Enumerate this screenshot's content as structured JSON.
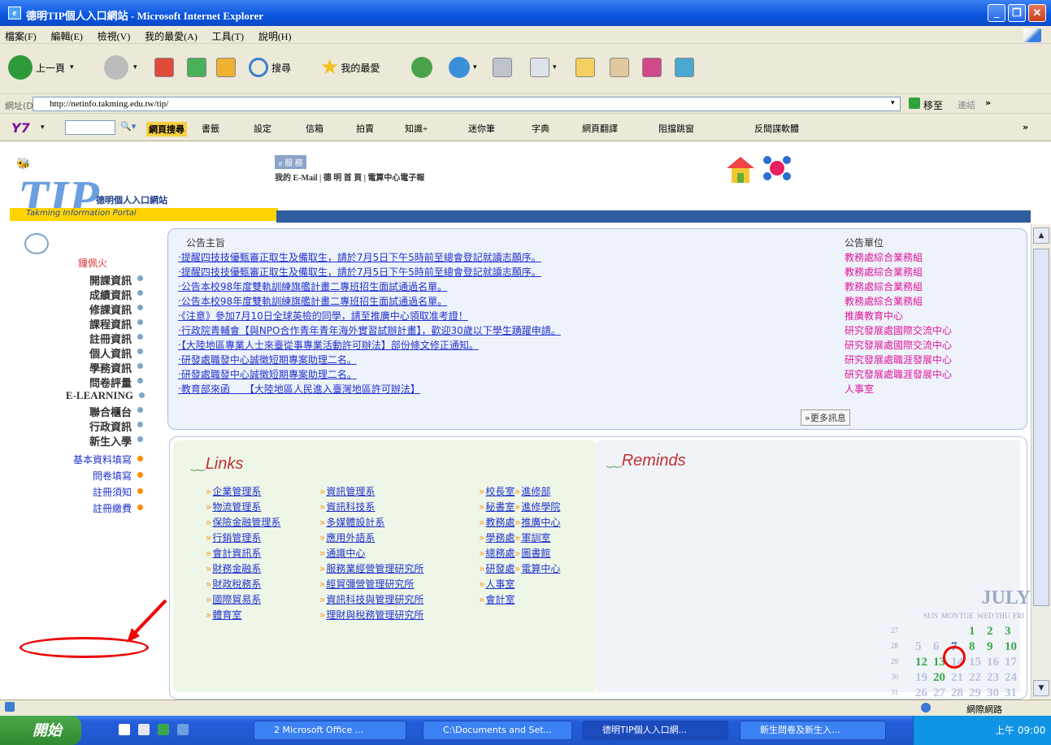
{
  "window": {
    "title": "德明TIP個人入口網站 - Microsoft Internet Explorer",
    "buttons": [
      "_",
      "❐",
      "✕"
    ]
  },
  "menubar": {
    "items": [
      "檔案(F)",
      "編輯(E)",
      "檢視(V)",
      "我的最愛(A)",
      "工具(T)",
      "說明(H)"
    ]
  },
  "toolbar": {
    "back_label": "上一頁",
    "search_label": "搜尋",
    "favorites_label": "我的最愛"
  },
  "address": {
    "label": "網址(D)",
    "url": "http://netinfo.takming.edu.tw/tip/",
    "go_label": "移至",
    "links_label": "連結"
  },
  "yahoo": {
    "logo": "Y7",
    "items": [
      "網頁搜尋",
      "書籤",
      "設定",
      "信箱",
      "拍賣",
      "知識+",
      "迷你筆",
      "字典",
      "網頁翻譯",
      "阻擋跳窗",
      "反間諜軟體"
    ]
  },
  "header": {
    "logo_text": "TIP",
    "logo_sub": "德明個人入口網站",
    "logo_en": "Takming Information Portal",
    "email_tag": "e 服 務",
    "email_links": "我的 E-Mail | 德 明 首 頁 | 電算中心電子報"
  },
  "leftnav": {
    "user_name": "鍾佩火",
    "items": [
      {
        "label": "開課資訊",
        "link": false
      },
      {
        "label": "成績資訊",
        "link": false
      },
      {
        "label": "修課資訊",
        "link": false
      },
      {
        "label": "課程資訊",
        "link": false
      },
      {
        "label": "註冊資訊",
        "link": false
      },
      {
        "label": "個人資訊",
        "link": false
      },
      {
        "label": "學務資訊",
        "link": false
      },
      {
        "label": "問卷評量",
        "link": false
      },
      {
        "label": "E-LEARNING",
        "link": false
      },
      {
        "label": "聯合櫃台",
        "link": false
      },
      {
        "label": "行政資訊",
        "link": false
      },
      {
        "label": "新生入學",
        "link": false
      },
      {
        "label": "基本資料填寫",
        "link": true
      },
      {
        "label": "問卷填寫",
        "link": true
      },
      {
        "label": "註冊須知",
        "link": true
      },
      {
        "label": "註冊繳費",
        "link": true
      }
    ]
  },
  "announcements": {
    "header": "公告主旨",
    "unit_header": "公告單位",
    "more": "»更多訊息",
    "items": [
      {
        "subject": "‧提醒四技技優甄審正取生及備取生，請於7月5日下午5時前至總會登記就讀志願序。",
        "unit": "教務處綜合業務組"
      },
      {
        "subject": "‧提醒四技技優甄審正取生及備取生，請於7月5日下午5時前至總會登記就讀志願序。",
        "unit": "教務處綜合業務組"
      },
      {
        "subject": "‧公告本校98年度雙軌訓練旗艦計畫二專班招生面試通過名單。",
        "unit": "教務處綜合業務組"
      },
      {
        "subject": "‧公告本校98年度雙軌訓練旗艦計畫二專班招生面試通過名單。",
        "unit": "教務處綜合業務組"
      },
      {
        "subject": "‧《注意》參加7月10日全球英檢的同學，請至推廣中心領取准考證！",
        "unit": "推廣教育中心"
      },
      {
        "subject": "‧行政院青輔會【與NPO合作青年青年海外實習試辦計畫】，歡迎30歲以下學生踴躍申請。",
        "unit": "研究發展處國際交流中心"
      },
      {
        "subject": "‧【大陸地區專業人士來臺從事專業活動許可辦法】部份條文修正通知。",
        "unit": "研究發展處國際交流中心"
      },
      {
        "subject": "‧研發處職發中心誠徵短期專案助理二名。",
        "unit": "研究發展處職涯發展中心"
      },
      {
        "subject": "‧研發處職發中心誠徵短期專案助理二名。",
        "unit": "研究發展處職涯發展中心"
      },
      {
        "subject": "‧教育部來函　　【大陸地區人民進入臺灣地區許可辦法】",
        "unit": "人事室"
      }
    ]
  },
  "links": {
    "header": "Links",
    "col1": [
      "企業管理系",
      "物流管理系",
      "保險金融管理系",
      "行銷管理系",
      "會計資訊系",
      "財務金融系",
      "財政稅務系",
      "國際貿易系",
      "體育室"
    ],
    "col2": [
      "資訊管理系",
      "資訊科技系",
      "多媒體設計系",
      "應用外語系",
      "通識中心",
      "服務業經營管理研究所",
      "經貿彌營管理研究所",
      "資訊科技與管理研究所",
      "理財與稅務管理研究所"
    ],
    "col3": [
      "校長室",
      "秘書室",
      "教務處",
      "學務處",
      "總務處",
      "研發處",
      "人事室",
      "會計室"
    ],
    "col4": [
      "進修部",
      "進修學院",
      "推廣中心",
      "軍訓室",
      "圖書館",
      "電算中心"
    ]
  },
  "reminds": {
    "header": "Reminds"
  },
  "calendar": {
    "month": "JULY",
    "weekdays": [
      "SUN",
      "MON",
      "TUE",
      "WED",
      "THU",
      "FRI"
    ],
    "weeks": [
      {
        "num": "27",
        "days": [
          "",
          "",
          "",
          "1",
          "2",
          "3"
        ]
      },
      {
        "num": "28",
        "days": [
          "5",
          "6",
          "7",
          "8",
          "9",
          "10"
        ]
      },
      {
        "num": "29",
        "days": [
          "12",
          "13",
          "14",
          "15",
          "16",
          "17"
        ]
      },
      {
        "num": "30",
        "days": [
          "19",
          "20",
          "21",
          "22",
          "23",
          "24"
        ]
      },
      {
        "num": "31",
        "days": [
          "26",
          "27",
          "28",
          "29",
          "30",
          "31"
        ]
      }
    ]
  },
  "status": {
    "zone": "網際網路"
  },
  "taskbar": {
    "start": "開始",
    "tasks": [
      "2 Microsoft Office ...",
      "C:\\Documents and Set...",
      "德明TIP個人入口網...",
      "新生問卷及新生入..."
    ],
    "clock": "上午 09:00"
  },
  "colors": {
    "link": "#2233cc",
    "unit": "#e0189a",
    "annotation": "#ee0000",
    "titlebar": "#0a55dd"
  }
}
